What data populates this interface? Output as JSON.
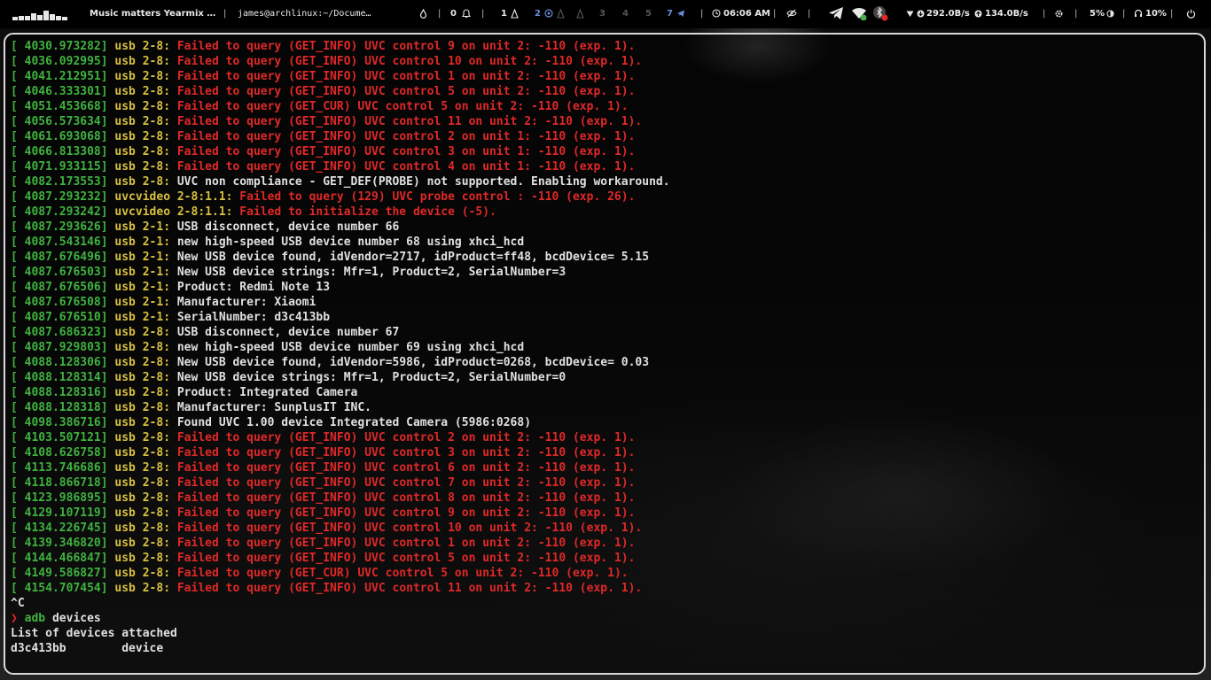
{
  "topbar": {
    "media_title": "Music matters Yearmix …",
    "window_title": "james@archlinux:~/Docume…",
    "notif_count": "0",
    "workspaces": [
      {
        "label": "1",
        "state": "active"
      },
      {
        "label": "2",
        "state": "blue"
      },
      {
        "label": "3",
        "state": "inactive"
      },
      {
        "label": "4",
        "state": "inactive"
      },
      {
        "label": "5",
        "state": "inactive"
      },
      {
        "label": "7",
        "state": "blue"
      }
    ],
    "clock": "06:06 AM",
    "net_down": "292.0B/s",
    "net_up": "134.0B/s",
    "brightness": "5%",
    "volume": "10%",
    "icons": [
      "drop-icon",
      "bell-icon",
      "eye-off-icon",
      "telegram-icon",
      "wifi-icon",
      "bluetooth-icon",
      "gear-icon",
      "power-icon"
    ]
  },
  "terminal": {
    "log": [
      {
        "ts": "[ 4030.973282]",
        "src": "usb 2-8:",
        "msg": "Failed to query (GET_INFO) UVC control 9 on unit 2: -110 (exp. 1).",
        "kind": "err"
      },
      {
        "ts": "[ 4036.092995]",
        "src": "usb 2-8:",
        "msg": "Failed to query (GET_INFO) UVC control 10 on unit 2: -110 (exp. 1).",
        "kind": "err"
      },
      {
        "ts": "[ 4041.212951]",
        "src": "usb 2-8:",
        "msg": "Failed to query (GET_INFO) UVC control 1 on unit 2: -110 (exp. 1).",
        "kind": "err"
      },
      {
        "ts": "[ 4046.333301]",
        "src": "usb 2-8:",
        "msg": "Failed to query (GET_INFO) UVC control 5 on unit 2: -110 (exp. 1).",
        "kind": "err"
      },
      {
        "ts": "[ 4051.453668]",
        "src": "usb 2-8:",
        "msg": "Failed to query (GET_CUR) UVC control 5 on unit 2: -110 (exp. 1).",
        "kind": "err"
      },
      {
        "ts": "[ 4056.573634]",
        "src": "usb 2-8:",
        "msg": "Failed to query (GET_INFO) UVC control 11 on unit 2: -110 (exp. 1).",
        "kind": "err"
      },
      {
        "ts": "[ 4061.693068]",
        "src": "usb 2-8:",
        "msg": "Failed to query (GET_INFO) UVC control 2 on unit 1: -110 (exp. 1).",
        "kind": "err"
      },
      {
        "ts": "[ 4066.813308]",
        "src": "usb 2-8:",
        "msg": "Failed to query (GET_INFO) UVC control 3 on unit 1: -110 (exp. 1).",
        "kind": "err"
      },
      {
        "ts": "[ 4071.933115]",
        "src": "usb 2-8:",
        "msg": "Failed to query (GET_INFO) UVC control 4 on unit 1: -110 (exp. 1).",
        "kind": "err"
      },
      {
        "ts": "[ 4082.173553]",
        "src": "usb 2-8:",
        "msg": "UVC non compliance - GET_DEF(PROBE) not supported. Enabling workaround.",
        "kind": "msg"
      },
      {
        "ts": "[ 4087.293232]",
        "src": "uvcvideo 2-8:1.1:",
        "msg": "Failed to query (129) UVC probe control : -110 (exp. 26).",
        "kind": "err"
      },
      {
        "ts": "[ 4087.293242]",
        "src": "uvcvideo 2-8:1.1:",
        "msg": "Failed to initialize the device (-5).",
        "kind": "err"
      },
      {
        "ts": "[ 4087.293626]",
        "src": "usb 2-1:",
        "msg": "USB disconnect, device number 66",
        "kind": "msg"
      },
      {
        "ts": "[ 4087.543146]",
        "src": "usb 2-1:",
        "msg": "new high-speed USB device number 68 using xhci_hcd",
        "kind": "msg"
      },
      {
        "ts": "[ 4087.676496]",
        "src": "usb 2-1:",
        "msg": "New USB device found, idVendor=2717, idProduct=ff48, bcdDevice= 5.15",
        "kind": "msg"
      },
      {
        "ts": "[ 4087.676503]",
        "src": "usb 2-1:",
        "msg": "New USB device strings: Mfr=1, Product=2, SerialNumber=3",
        "kind": "msg"
      },
      {
        "ts": "[ 4087.676506]",
        "src": "usb 2-1:",
        "msg": "Product: Redmi Note 13",
        "kind": "msg"
      },
      {
        "ts": "[ 4087.676508]",
        "src": "usb 2-1:",
        "msg": "Manufacturer: Xiaomi",
        "kind": "msg"
      },
      {
        "ts": "[ 4087.676510]",
        "src": "usb 2-1:",
        "msg": "SerialNumber: d3c413bb",
        "kind": "msg"
      },
      {
        "ts": "[ 4087.686323]",
        "src": "usb 2-8:",
        "msg": "USB disconnect, device number 67",
        "kind": "msg"
      },
      {
        "ts": "[ 4087.929803]",
        "src": "usb 2-8:",
        "msg": "new high-speed USB device number 69 using xhci_hcd",
        "kind": "msg"
      },
      {
        "ts": "[ 4088.128306]",
        "src": "usb 2-8:",
        "msg": "New USB device found, idVendor=5986, idProduct=0268, bcdDevice= 0.03",
        "kind": "msg"
      },
      {
        "ts": "[ 4088.128314]",
        "src": "usb 2-8:",
        "msg": "New USB device strings: Mfr=1, Product=2, SerialNumber=0",
        "kind": "msg"
      },
      {
        "ts": "[ 4088.128316]",
        "src": "usb 2-8:",
        "msg": "Product: Integrated Camera",
        "kind": "msg"
      },
      {
        "ts": "[ 4088.128318]",
        "src": "usb 2-8:",
        "msg": "Manufacturer: SunplusIT INC.",
        "kind": "msg"
      },
      {
        "ts": "[ 4098.386716]",
        "src": "usb 2-8:",
        "msg": "Found UVC 1.00 device Integrated Camera (5986:0268)",
        "kind": "msg"
      },
      {
        "ts": "[ 4103.507121]",
        "src": "usb 2-8:",
        "msg": "Failed to query (GET_INFO) UVC control 2 on unit 2: -110 (exp. 1).",
        "kind": "err"
      },
      {
        "ts": "[ 4108.626758]",
        "src": "usb 2-8:",
        "msg": "Failed to query (GET_INFO) UVC control 3 on unit 2: -110 (exp. 1).",
        "kind": "err"
      },
      {
        "ts": "[ 4113.746686]",
        "src": "usb 2-8:",
        "msg": "Failed to query (GET_INFO) UVC control 6 on unit 2: -110 (exp. 1).",
        "kind": "err"
      },
      {
        "ts": "[ 4118.866718]",
        "src": "usb 2-8:",
        "msg": "Failed to query (GET_INFO) UVC control 7 on unit 2: -110 (exp. 1).",
        "kind": "err"
      },
      {
        "ts": "[ 4123.986895]",
        "src": "usb 2-8:",
        "msg": "Failed to query (GET_INFO) UVC control 8 on unit 2: -110 (exp. 1).",
        "kind": "err"
      },
      {
        "ts": "[ 4129.107119]",
        "src": "usb 2-8:",
        "msg": "Failed to query (GET_INFO) UVC control 9 on unit 2: -110 (exp. 1).",
        "kind": "err"
      },
      {
        "ts": "[ 4134.226745]",
        "src": "usb 2-8:",
        "msg": "Failed to query (GET_INFO) UVC control 10 on unit 2: -110 (exp. 1).",
        "kind": "err"
      },
      {
        "ts": "[ 4139.346820]",
        "src": "usb 2-8:",
        "msg": "Failed to query (GET_INFO) UVC control 1 on unit 2: -110 (exp. 1).",
        "kind": "err"
      },
      {
        "ts": "[ 4144.466847]",
        "src": "usb 2-8:",
        "msg": "Failed to query (GET_INFO) UVC control 5 on unit 2: -110 (exp. 1).",
        "kind": "err"
      },
      {
        "ts": "[ 4149.586827]",
        "src": "usb 2-8:",
        "msg": "Failed to query (GET_CUR) UVC control 5 on unit 2: -110 (exp. 1).",
        "kind": "err"
      },
      {
        "ts": "[ 4154.707454]",
        "src": "usb 2-8:",
        "msg": "Failed to query (GET_INFO) UVC control 11 on unit 2: -110 (exp. 1).",
        "kind": "err"
      }
    ],
    "interrupt": "^C",
    "prompt_symbol": "❯",
    "command_name": "adb",
    "command_args": " devices",
    "output": [
      "List of devices attached",
      "d3c413bb        device"
    ]
  }
}
